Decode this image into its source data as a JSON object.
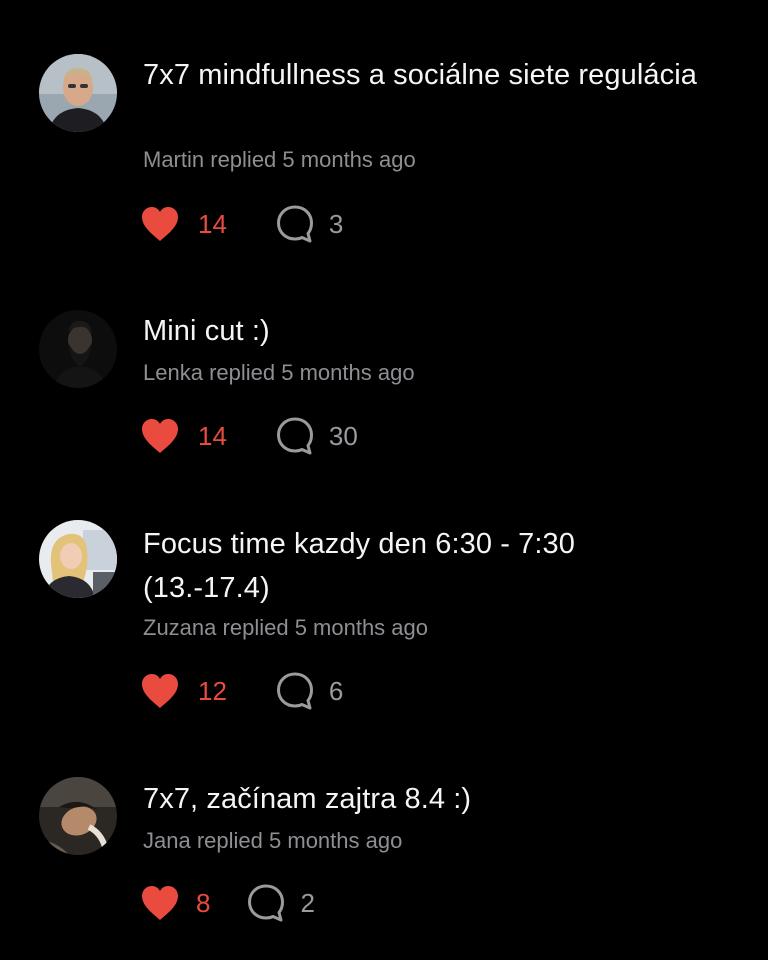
{
  "colors": {
    "background": "#000000",
    "title": "#f5f5f5",
    "meta": "#8e8e93",
    "like": "#ea4b3f",
    "comment": "#9a9a9f"
  },
  "icons": {
    "like": "heart-icon",
    "comment": "comment-bubble-icon"
  },
  "posts": [
    {
      "title": "7x7 mindfullness a sociálne siete regulácia",
      "author": "Martin",
      "verb": "replied",
      "time": "5 months ago",
      "likes": "14",
      "comments": "3"
    },
    {
      "title": "Mini cut :)",
      "author": "Lenka",
      "verb": "replied",
      "time": "5 months ago",
      "likes": "14",
      "comments": "30"
    },
    {
      "title": "Focus time kazdy den 6:30 - 7:30 (13.-17.4)",
      "author": "Zuzana",
      "verb": "replied",
      "time": "5 months ago",
      "likes": "12",
      "comments": "6"
    },
    {
      "title": "7x7, začínam zajtra 8.4 :)",
      "author": "Jana",
      "verb": "replied",
      "time": "5 months ago",
      "likes": "8",
      "comments": "2"
    }
  ]
}
